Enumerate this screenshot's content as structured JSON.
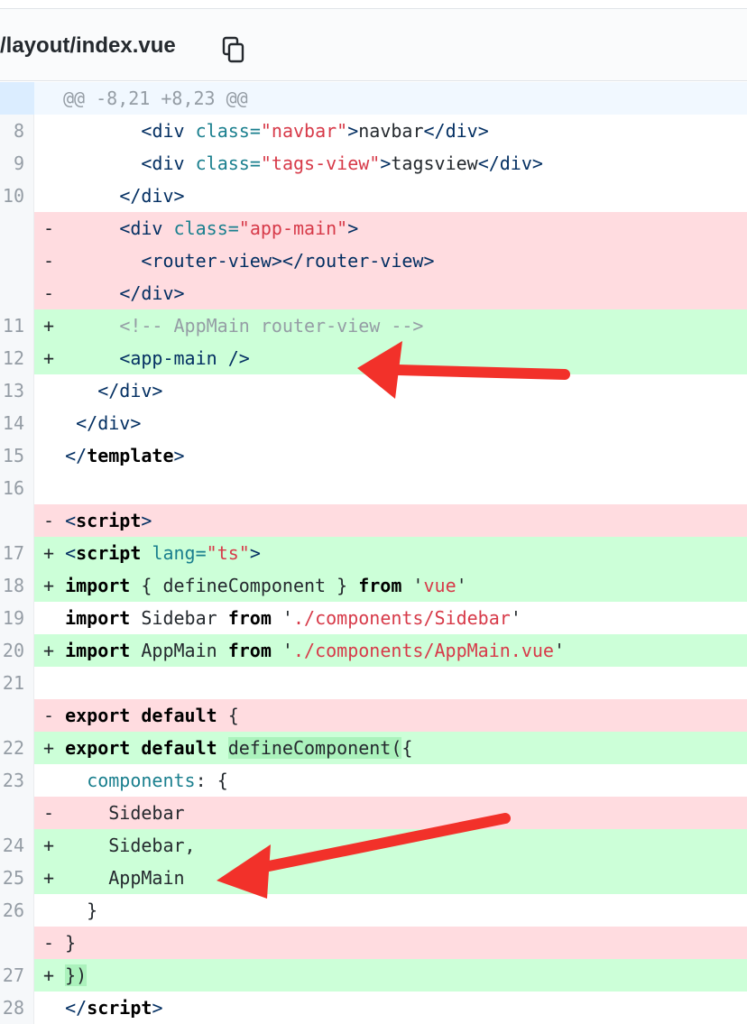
{
  "file": {
    "path": "/layout/index.vue",
    "copy_icon": "copy-icon"
  },
  "hunk": "@@ -8,21 +8,23 @@",
  "rows": [
    {
      "n": "8",
      "m": " ",
      "segs": [
        [
          "       ",
          "p"
        ],
        [
          "<",
          "nav"
        ],
        [
          "div ",
          "nav"
        ],
        [
          "class=",
          "attr"
        ],
        [
          "\"navbar\"",
          "str"
        ],
        [
          ">",
          "nav"
        ],
        [
          "navbar",
          "p"
        ],
        [
          "</div>",
          "nav"
        ]
      ]
    },
    {
      "n": "9",
      "m": " ",
      "segs": [
        [
          "       ",
          "p"
        ],
        [
          "<div ",
          "nav"
        ],
        [
          "class=",
          "attr"
        ],
        [
          "\"tags-view\"",
          "str"
        ],
        [
          ">",
          "nav"
        ],
        [
          "tagsview",
          "p"
        ],
        [
          "</div>",
          "nav"
        ]
      ]
    },
    {
      "n": "10",
      "m": " ",
      "segs": [
        [
          "     ",
          "p"
        ],
        [
          "</div>",
          "nav"
        ]
      ]
    },
    {
      "n": "",
      "m": "-",
      "type": "del",
      "segs": [
        [
          "     ",
          "p"
        ],
        [
          "<div ",
          "nav"
        ],
        [
          "class=",
          "attr"
        ],
        [
          "\"app-main\"",
          "str"
        ],
        [
          ">",
          "nav"
        ]
      ]
    },
    {
      "n": "",
      "m": "-",
      "type": "del",
      "segs": [
        [
          "       ",
          "p"
        ],
        [
          "<router-view></router-view>",
          "nav"
        ]
      ]
    },
    {
      "n": "",
      "m": "-",
      "type": "del",
      "segs": [
        [
          "     ",
          "p"
        ],
        [
          "</div>",
          "nav"
        ]
      ]
    },
    {
      "n": "11",
      "m": "+",
      "type": "add",
      "segs": [
        [
          "     ",
          "p"
        ],
        [
          "<!-- AppMain router-view -->",
          "cmt"
        ]
      ]
    },
    {
      "n": "12",
      "m": "+",
      "type": "add",
      "segs": [
        [
          "     ",
          "p"
        ],
        [
          "<app-main />",
          "nav"
        ]
      ]
    },
    {
      "n": "13",
      "m": " ",
      "segs": [
        [
          "   ",
          "p"
        ],
        [
          "</div>",
          "nav"
        ]
      ]
    },
    {
      "n": "14",
      "m": " ",
      "segs": [
        [
          " ",
          "p"
        ],
        [
          "</div>",
          "nav"
        ]
      ]
    },
    {
      "n": "15",
      "m": " ",
      "segs": [
        [
          "</",
          "nav"
        ],
        [
          "template",
          "kw"
        ],
        [
          ">",
          "nav"
        ]
      ]
    },
    {
      "n": "16",
      "m": " ",
      "segs": []
    },
    {
      "n": "",
      "m": "-",
      "type": "del",
      "segs": [
        [
          "<",
          "nav"
        ],
        [
          "script",
          "kw"
        ],
        [
          ">",
          "nav"
        ]
      ]
    },
    {
      "n": "17",
      "m": "+",
      "type": "add",
      "segs": [
        [
          "<",
          "nav"
        ],
        [
          "script ",
          "kw"
        ],
        [
          "lang=",
          "attr"
        ],
        [
          "\"ts\"",
          "str"
        ],
        [
          ">",
          "nav"
        ]
      ]
    },
    {
      "n": "18",
      "m": "+",
      "type": "add",
      "segs": [
        [
          "import",
          "kw"
        ],
        [
          " { defineComponent } ",
          "p"
        ],
        [
          "from",
          "kw"
        ],
        [
          " '",
          "p"
        ],
        [
          "vue",
          "str"
        ],
        [
          "'",
          "p"
        ]
      ]
    },
    {
      "n": "19",
      "m": " ",
      "segs": [
        [
          "import",
          "kw"
        ],
        [
          " Sidebar ",
          "p"
        ],
        [
          "from",
          "kw"
        ],
        [
          " '",
          "p"
        ],
        [
          "./components/Sidebar",
          "str"
        ],
        [
          "'",
          "p"
        ]
      ]
    },
    {
      "n": "20",
      "m": "+",
      "type": "add",
      "segs": [
        [
          "import",
          "kw"
        ],
        [
          " AppMain ",
          "p"
        ],
        [
          "from",
          "kw"
        ],
        [
          " '",
          "p"
        ],
        [
          "./components/AppMain.vue",
          "str"
        ],
        [
          "'",
          "p"
        ]
      ]
    },
    {
      "n": "21",
      "m": " ",
      "segs": []
    },
    {
      "n": "",
      "m": "-",
      "type": "del",
      "segs": [
        [
          "export default",
          "kw"
        ],
        [
          " {",
          "p"
        ]
      ]
    },
    {
      "n": "22",
      "m": "+",
      "type": "add",
      "segs": [
        [
          "export default",
          "kw"
        ],
        [
          " ",
          "p"
        ],
        [
          "defineComponent(",
          "hl"
        ],
        [
          "{",
          "p"
        ]
      ]
    },
    {
      "n": "23",
      "m": " ",
      "segs": [
        [
          "  ",
          "p"
        ],
        [
          "components",
          "prop"
        ],
        [
          ": {",
          "p"
        ]
      ]
    },
    {
      "n": "",
      "m": "-",
      "type": "del",
      "segs": [
        [
          "    Sidebar",
          "p"
        ]
      ]
    },
    {
      "n": "24",
      "m": "+",
      "type": "add",
      "segs": [
        [
          "    Sidebar,",
          "p"
        ]
      ]
    },
    {
      "n": "25",
      "m": "+",
      "type": "add",
      "segs": [
        [
          "    AppMain",
          "p"
        ]
      ]
    },
    {
      "n": "26",
      "m": " ",
      "segs": [
        [
          "  }",
          "p"
        ]
      ]
    },
    {
      "n": "",
      "m": "-",
      "type": "del",
      "segs": [
        [
          "}",
          "p"
        ]
      ]
    },
    {
      "n": "27",
      "m": "+",
      "type": "add",
      "segs": [
        [
          "})",
          "hl"
        ]
      ]
    },
    {
      "n": "28",
      "m": " ",
      "segs": [
        [
          "</",
          "nav"
        ],
        [
          "script",
          "kw"
        ],
        [
          ">",
          "nav"
        ]
      ]
    }
  ],
  "colors": {
    "annotation_arrow": "#f2312a",
    "added_bg": "#ccffd8",
    "removed_bg": "#ffdce0"
  }
}
